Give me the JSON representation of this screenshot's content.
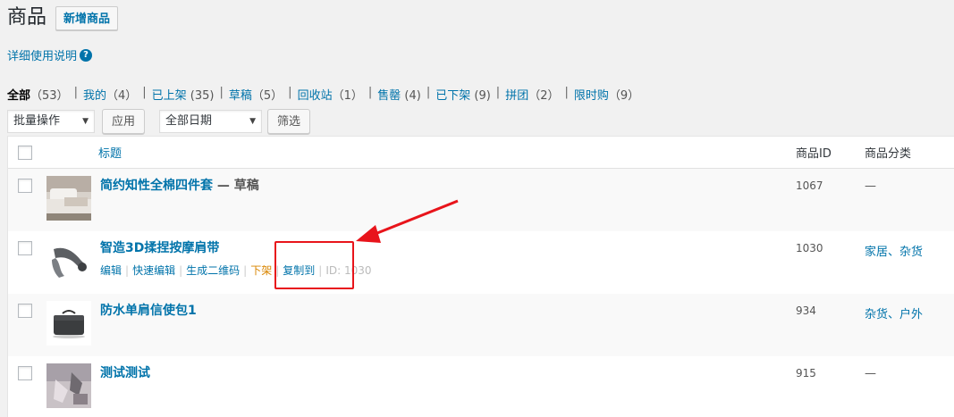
{
  "header": {
    "title": "商品",
    "add_new_label": "新增商品"
  },
  "help": {
    "label": "详细使用说明",
    "icon": "?"
  },
  "filters": [
    {
      "label": "全部",
      "count": "（53）",
      "current": true
    },
    {
      "label": "我的",
      "count": "（4）"
    },
    {
      "label": "已上架",
      "count": "(35)"
    },
    {
      "label": "草稿",
      "count": "（5）"
    },
    {
      "label": "回收站",
      "count": "（1）"
    },
    {
      "label": "售罄",
      "count": "(4)"
    },
    {
      "label": "已下架",
      "count": "(9)"
    },
    {
      "label": "拼团",
      "count": "（2）"
    },
    {
      "label": "限时购",
      "count": "（9）"
    }
  ],
  "toolbar": {
    "bulk_action": "批量操作",
    "apply_label": "应用",
    "date_filter": "全部日期",
    "filter_label": "筛选"
  },
  "table": {
    "columns": {
      "title": "标题",
      "id": "商品ID",
      "category": "商品分类"
    },
    "rows": [
      {
        "title": "简约知性全棉四件套",
        "state": " — 草稿",
        "id": "1067",
        "category": "—"
      },
      {
        "title": "智造3D揉捏按摩肩带",
        "id": "1030",
        "category": "家居、杂货",
        "actions": {
          "edit": "编辑",
          "quick_edit": "快速编辑",
          "qrcode": "生成二维码",
          "unpublish": "下架",
          "copy_to": "复制到",
          "id_text": "ID: 1030"
        }
      },
      {
        "title": "防水单肩信使包1",
        "id": "934",
        "category": "杂货、户外"
      },
      {
        "title": "测试测试",
        "id": "915",
        "category": "—"
      }
    ]
  }
}
